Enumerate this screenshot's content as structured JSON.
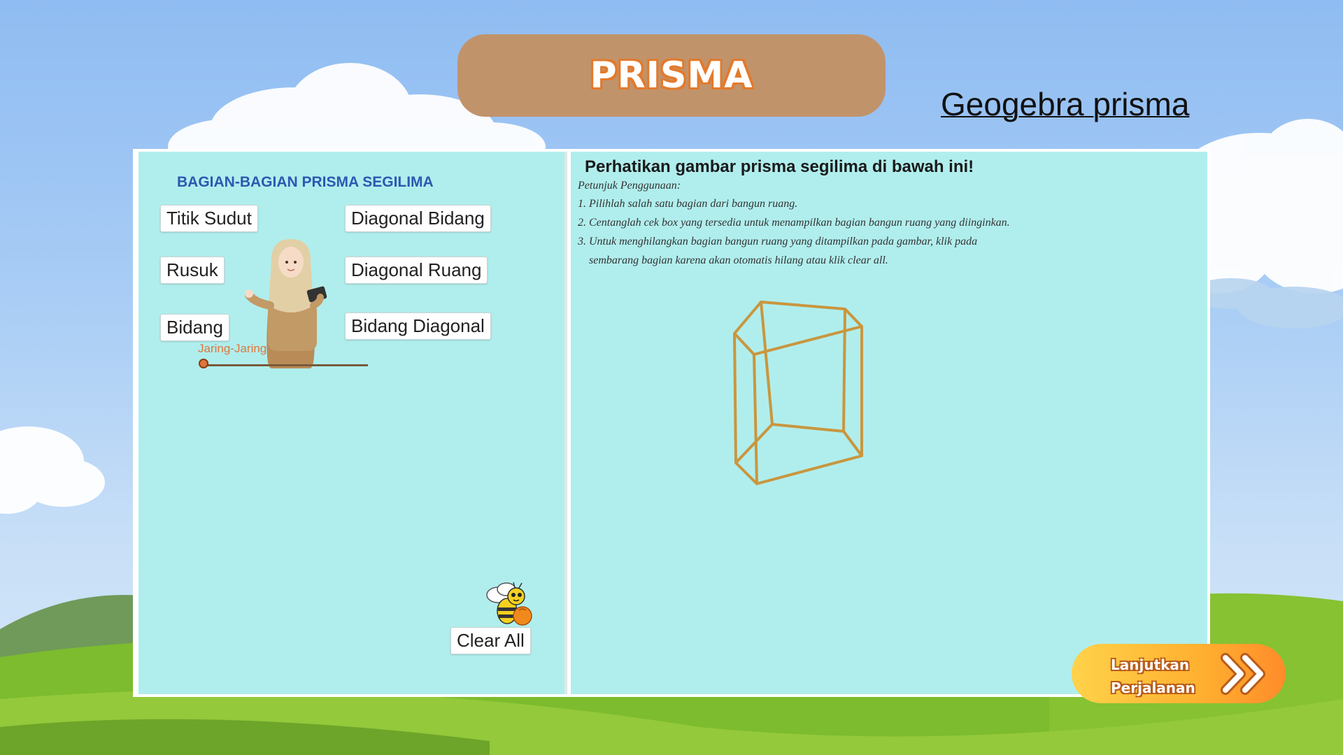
{
  "header": {
    "title": "PRISMA",
    "link_text": "Geogebra prisma"
  },
  "left_panel": {
    "title": "BAGIAN-BAGIAN PRISMA SEGILIMA",
    "buttons": {
      "titik_sudut": "Titik Sudut",
      "rusuk": "Rusuk",
      "bidang": "Bidang",
      "diagonal_bidang": "Diagonal Bidang",
      "diagonal_ruang": "Diagonal Ruang",
      "bidang_diagonal": "Bidang Diagonal",
      "clear_all": "Clear All"
    },
    "slider_label": "Jaring-Jaring",
    "slider_value": 0
  },
  "right_panel": {
    "title": "Perhatikan gambar prisma segilima di bawah ini!",
    "instructions_heading": "Petunjuk Penggunaan:",
    "instructions": [
      "1. Pilihlah salah satu bagian dari bangun ruang.",
      "2. Centanglah cek box yang tersedia untuk menampilkan bagian bangun ruang yang diinginkan.",
      "3. Untuk menghilangkan bagian bangun ruang yang ditampilkan pada gambar, klik pada",
      "    sembarang bagian karena akan otomatis hilang atau klik clear all."
    ]
  },
  "continue_button": {
    "line1": "Lanjutkan",
    "line2": "Perjalanan"
  },
  "colors": {
    "title_pill": "#c1936b",
    "panel_bg": "#b0eeed",
    "prism_edge": "#c9963e",
    "accent_orange": "#e0763d",
    "title_blue": "#2d58b0"
  },
  "icons": {
    "teacher": "teacher-illustration",
    "bee": "bee-icon",
    "chevrons": "double-chevron-right-icon"
  }
}
